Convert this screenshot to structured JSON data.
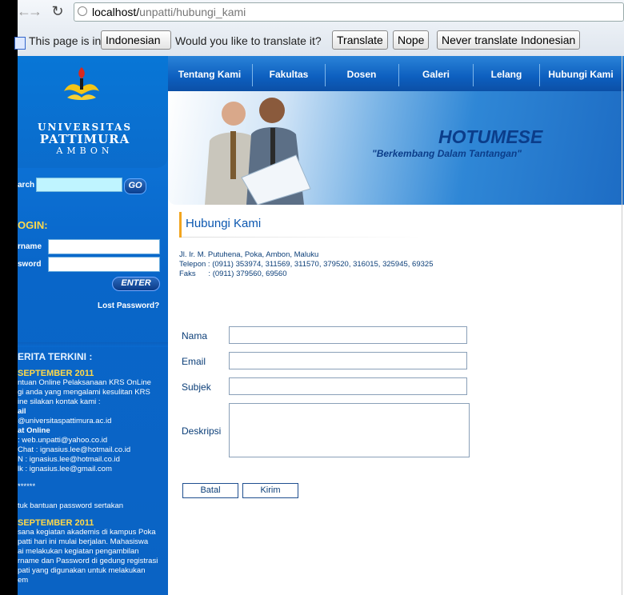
{
  "browser": {
    "url_host": "localhost/",
    "url_path": "unpatti/hubungi_kami",
    "translate_prefix": "This page is in",
    "language": "Indonesian",
    "translate_question": "Would you like to translate it?",
    "translate_btn": "Translate",
    "nope_btn": "Nope",
    "never_btn": "Never translate Indonesian"
  },
  "logo": {
    "line1": "UNIVERSITAS",
    "line2": "PATTIMURA",
    "line3": "AMBON"
  },
  "sidebar": {
    "search_label": "arch",
    "go": "GO",
    "login_title": "OGIN:",
    "username_label": "rname",
    "password_label": "sword",
    "enter": "ENTER",
    "lost_password": "Lost Password?",
    "news_title": "ERITA TERKINI :",
    "news1_date": "SEPTEMBER 2011",
    "news1_l1": "ntuan Online Pelaksanaan KRS OnLine",
    "news1_l2": "gi anda yang mengalami kesulitan KRS",
    "news1_l3": "ine silakan kontak kami :",
    "news1_l4": "ail",
    "news1_l5": "@universitaspattimura.ac.id",
    "news1_l6": "at Online",
    "news1_l7": ": web.unpatti@yahoo.co.id",
    "news1_l8": "Chat  : ignasius.lee@hotmail.co.id",
    "news1_l9": "N : ignasius.lee@hotmail.co.id",
    "news1_l10": "lk : ignasius.lee@gmail.com",
    "news1_l11": "******",
    "news1_l12": "tuk bantuan password sertakan",
    "news2_date": "SEPTEMBER 2011",
    "news2_l1": "sana kegiatan akademis di kampus Poka",
    "news2_l2": "patti hari ini mulai berjalan. Mahasiswa",
    "news2_l3": "ai melakukan kegiatan pengambilan",
    "news2_l4": "rname dan Password di gedung registrasi",
    "news2_l5": "pati yang digunakan untuk melakukan",
    "news2_l6": "em"
  },
  "nav": [
    "Tentang Kami",
    "Fakultas",
    "Dosen",
    "Galeri",
    "Lelang",
    "Hubungi Kami"
  ],
  "banner": {
    "title": "HOTUMESE",
    "motto": "\"Berkembang Dalam Tantangan\""
  },
  "page": {
    "heading": "Hubungi Kami",
    "address": "Jl. Ir. M. Putuhena, Poka, Ambon, Maluku",
    "phone": "Telepon : (0911) 353974, 311569, 311570, 379520, 316015, 325945, 69325",
    "fax": "Faks      : (0911) 379560, 69560"
  },
  "form": {
    "nama": "Nama",
    "email": "Email",
    "subjek": "Subjek",
    "deskripsi": "Deskripsi",
    "batal": "Batal",
    "kirim": "Kirim"
  },
  "colors": {
    "sidebar": "#0a6ad0",
    "accent": "#f2a51f",
    "link": "#0b57b0"
  }
}
